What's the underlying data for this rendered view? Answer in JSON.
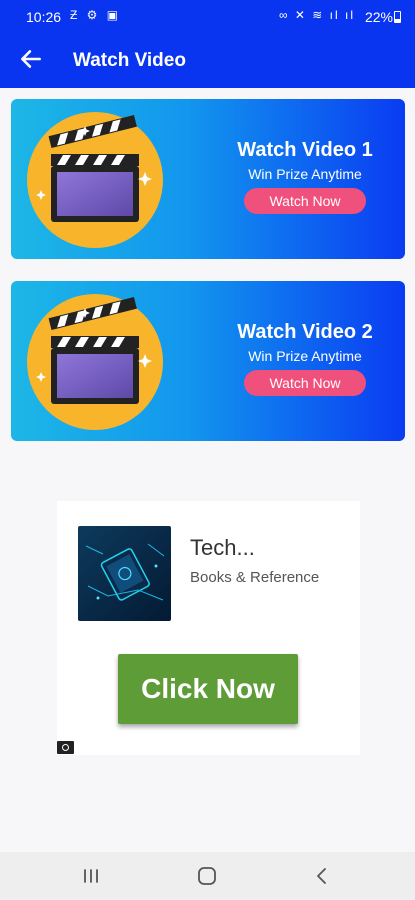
{
  "status_bar": {
    "time": "10:26",
    "left_icons": "Ƶ ⚙ ▣",
    "right_icons": "∞ ✕ ≋ ıl ıl",
    "battery": "22%"
  },
  "app_bar": {
    "title": "Watch Video",
    "back_icon": "arrow-left-icon"
  },
  "cards": [
    {
      "title": "Watch Video 1",
      "subtitle": "Win Prize Anytime",
      "button": "Watch Now"
    },
    {
      "title": "Watch Video 2",
      "subtitle": "Win Prize Anytime",
      "button": "Watch Now"
    }
  ],
  "ad": {
    "title": "Tech...",
    "category": "Books & Reference",
    "button": "Click Now"
  },
  "colors": {
    "brand": "#0a35f0",
    "watch_button": "#f0507c",
    "ad_button": "#5e9c38"
  }
}
